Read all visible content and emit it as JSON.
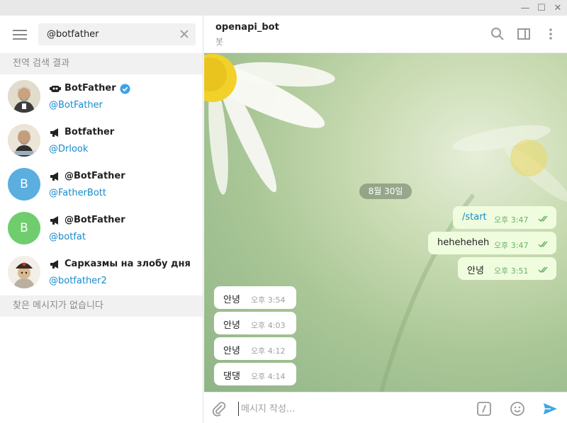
{
  "window": {
    "minimize_glyph": "—",
    "maximize_glyph": "☐",
    "close_glyph": "✕"
  },
  "search": {
    "value": "@botfather"
  },
  "sections": {
    "global_results": "전역 검색 결과",
    "no_messages": "찾은 메시지가 없습니다"
  },
  "results": [
    {
      "name": "BotFather",
      "username": "@BotFather",
      "avatar": "illustration",
      "verified": true
    },
    {
      "name": "Botfather",
      "username": "@Drlook",
      "avatar": "illustration"
    },
    {
      "name": "@BotFather",
      "username": "@FatherBott",
      "avatar_letter": "B",
      "avatar_color": "#5aaee0"
    },
    {
      "name": "@BotFather",
      "username": "@botfat",
      "avatar_letter": "B",
      "avatar_color": "#6fcd6d"
    },
    {
      "name": "Сарказмы на злобу дня",
      "username": "@botfather2",
      "avatar": "illustration"
    }
  ],
  "chat": {
    "title": "openapi_bot",
    "subtitle": "봇",
    "date": "8월 30일",
    "outgoing": [
      {
        "text": "/start",
        "time": "오후 3:47"
      },
      {
        "text": "heheheheh",
        "time": "오후 3:47"
      },
      {
        "text": "안녕",
        "time": "오후 3:51"
      }
    ],
    "incoming": [
      {
        "text": "안녕",
        "time": "오후 3:54"
      },
      {
        "text": "안녕",
        "time": "오후 4:03"
      },
      {
        "text": "안녕",
        "time": "오후 4:12"
      },
      {
        "text": "댕댕",
        "time": "오후 4:14"
      }
    ]
  },
  "composer": {
    "placeholder": "메시지 작성..."
  },
  "colors": {
    "accent": "#168acd",
    "outgoing_bubble": "#effdde",
    "read_check": "#6cb067",
    "send": "#40a7e3"
  },
  "icons": [
    "hamburger-icon",
    "clear-icon",
    "search-icon",
    "sidebar-toggle-icon",
    "more-icon",
    "attach-icon",
    "commands-icon",
    "emoji-icon",
    "send-icon"
  ]
}
